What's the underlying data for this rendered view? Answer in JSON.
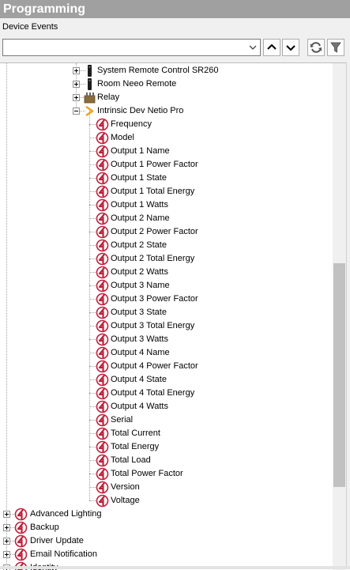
{
  "panel": {
    "title": "Programming"
  },
  "section": {
    "title": "Device Events"
  },
  "toolbar": {
    "combo_value": "",
    "buttons": [
      "up-arrow",
      "down-arrow",
      "refresh",
      "filter"
    ]
  },
  "devices": [
    {
      "label": "System Remote Control SR260",
      "icon": "remote-icon",
      "expander": "plus"
    },
    {
      "label": "Room Neeo Remote",
      "icon": "remote-icon",
      "expander": "plus"
    },
    {
      "label": "Relay",
      "icon": "relay-icon",
      "expander": "plus"
    },
    {
      "label": "Intrinsic Dev Netio Pro",
      "icon": "driver-arrow-icon",
      "expander": "minus"
    }
  ],
  "events": [
    "Frequency",
    "Model",
    "Output 1 Name",
    "Output 1 Power Factor",
    "Output 1 State",
    "Output 1 Total Energy",
    "Output 1 Watts",
    "Output 2 Name",
    "Output 2 Power Factor",
    "Output 2 State",
    "Output 2 Total Energy",
    "Output 2 Watts",
    "Output 3 Name",
    "Output 3 Power Factor",
    "Output 3 State",
    "Output 3 Total Energy",
    "Output 3 Watts",
    "Output 4 Name",
    "Output 4 Power Factor",
    "Output 4 State",
    "Output 4 Total Energy",
    "Output 4 Watts",
    "Serial",
    "Total Current",
    "Total Energy",
    "Total Load",
    "Total Power Factor",
    "Version",
    "Voltage"
  ],
  "categories": [
    "Advanced Lighting",
    "Backup",
    "Driver Update",
    "Email Notification",
    "Identity"
  ],
  "colors": {
    "event_icon": "#c0203a",
    "title_bar": "#a0a0a0",
    "driver_arrow": "#f0a020"
  }
}
